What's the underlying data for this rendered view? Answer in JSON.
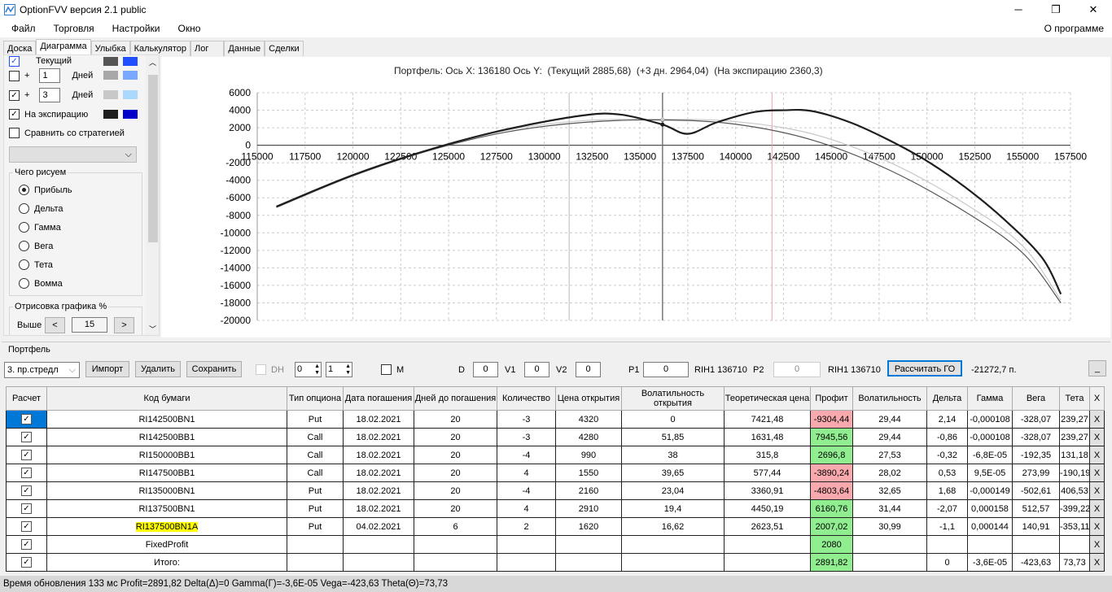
{
  "window": {
    "title": "OptionFVV версия 2.1 public",
    "minimize": "─",
    "maximize": "❐",
    "close": "✕"
  },
  "menu": {
    "items": [
      "Файл",
      "Торговля",
      "Настройки",
      "Окно"
    ],
    "about": "О программе"
  },
  "tabs": [
    "Доска",
    "Диаграмма",
    "Улыбка",
    "Калькулятор",
    "Лог",
    "Данные",
    "Сделки"
  ],
  "left": {
    "current_label": "Текущий",
    "plus": "+",
    "days_label": "Дней",
    "day1": "1",
    "day2": "3",
    "expiration_label": "На экспирацию",
    "compare_label": "Сравнить со стратегией",
    "draw_group": "Чего рисуем",
    "radios": [
      "Прибыль",
      "Дельта",
      "Гамма",
      "Вега",
      "Тета",
      "Вомма"
    ],
    "render_group": "Отрисовка графика %",
    "above_label": "Выше",
    "above_value": "15",
    "prev": "<",
    "next": ">",
    "colors": {
      "current": [
        "#555555",
        "#1f4fff"
      ],
      "d1": [
        "#a8a8a8",
        "#7aa7ff"
      ],
      "d3": [
        "#c8c8c8",
        "#aad8ff"
      ],
      "exp": [
        "#1e1e1e",
        "#0000c8"
      ]
    }
  },
  "chart_data": {
    "type": "line",
    "title": "Портфель: Ось X: 136180 Ось Y:  (Текущий 2885,68)  (+3 дн. 2964,04)  (На экспирацию 2360,3)",
    "xlim": [
      115000,
      157500
    ],
    "ylim": [
      -20000,
      6000
    ],
    "xticks": [
      "115000",
      "117500",
      "120000",
      "122500",
      "125000",
      "127500",
      "130000",
      "132500",
      "135000",
      "137500",
      "140000",
      "142500",
      "145000",
      "147500",
      "150000",
      "152500",
      "155000",
      "157500"
    ],
    "yticks": [
      "6000",
      "4000",
      "2000",
      "0",
      "-2000",
      "-4000",
      "-6000",
      "-8000",
      "-10000",
      "-12000",
      "-14000",
      "-16000",
      "-18000",
      "-20000"
    ],
    "cursor_x": 136180,
    "marker_x": 141900,
    "aux_x": 131300,
    "series": [
      {
        "name": "На экспирацию",
        "color": "#1e1e1e",
        "points": [
          [
            116000,
            -7000
          ],
          [
            120000,
            -3400
          ],
          [
            124000,
            -500
          ],
          [
            128000,
            1800
          ],
          [
            132000,
            3400
          ],
          [
            134000,
            3500
          ],
          [
            136180,
            2360
          ],
          [
            137500,
            1300
          ],
          [
            139000,
            2600
          ],
          [
            141000,
            3800
          ],
          [
            142500,
            4000
          ],
          [
            144000,
            3900
          ],
          [
            146000,
            2600
          ],
          [
            148000,
            600
          ],
          [
            150000,
            -1800
          ],
          [
            152000,
            -4800
          ],
          [
            154000,
            -8400
          ],
          [
            156000,
            -12800
          ],
          [
            157000,
            -17000
          ]
        ]
      },
      {
        "name": "Текущий",
        "color": "#555555",
        "points": [
          [
            116000,
            -7100
          ],
          [
            120000,
            -3500
          ],
          [
            124000,
            -600
          ],
          [
            128000,
            1500
          ],
          [
            132000,
            2600
          ],
          [
            136180,
            2886
          ],
          [
            140000,
            2400
          ],
          [
            144000,
            600
          ],
          [
            148000,
            -2800
          ],
          [
            152000,
            -7600
          ],
          [
            155000,
            -12300
          ],
          [
            157000,
            -18000
          ]
        ]
      },
      {
        "name": "+3 дн.",
        "color": "#c8c8c8",
        "points": [
          [
            124000,
            -500
          ],
          [
            128000,
            1700
          ],
          [
            132000,
            2800
          ],
          [
            136180,
            2964
          ],
          [
            140000,
            2700
          ],
          [
            144000,
            1300
          ],
          [
            148000,
            -1900
          ],
          [
            152000,
            -6700
          ],
          [
            155000,
            -11500
          ],
          [
            157000,
            -17700
          ]
        ]
      }
    ]
  },
  "portfolio": {
    "group": "Портфель",
    "strategy": "3. пр.стредл",
    "import": "Импорт",
    "delete": "Удалить",
    "save": "Сохранить",
    "dh": "DH",
    "spin1": "0",
    "spin2": "1",
    "m": "M",
    "d_label": "D",
    "d": "0",
    "v1_label": "V1",
    "v1": "0",
    "v2_label": "V2",
    "v2": "0",
    "p1_label": "P1",
    "p1": "0",
    "p1_info": "RIH1 136710",
    "p2_label": "P2",
    "p2": "0",
    "p2_info": "RIH1 136710",
    "calc": "Рассчитать ГО",
    "go_value": "-21272,7 п.",
    "min": "_"
  },
  "table": {
    "headers": [
      "Расчет",
      "Код бумаги",
      "Тип опциона",
      "Дата погашения",
      "Дней до погашения",
      "Количество",
      "Цена открытия",
      "Волатильность открытия",
      "Теоретическая цена",
      "Профит",
      "Волатильность",
      "Дельта",
      "Гамма",
      "Вега",
      "Тета",
      "X"
    ],
    "rows": [
      [
        "RI142500BN1",
        "Put",
        "18.02.2021",
        "20",
        "-3",
        "4320",
        "0",
        "7421,48",
        "-9304,44",
        "29,44",
        "2,14",
        "-0,000108",
        "-328,07",
        "239,27",
        "neg"
      ],
      [
        "RI142500BB1",
        "Call",
        "18.02.2021",
        "20",
        "-3",
        "4280",
        "51,85",
        "1631,48",
        "7945,56",
        "29,44",
        "-0,86",
        "-0,000108",
        "-328,07",
        "239,27",
        "pos"
      ],
      [
        "RI150000BB1",
        "Call",
        "18.02.2021",
        "20",
        "-4",
        "990",
        "38",
        "315,8",
        "2696,8",
        "27,53",
        "-0,32",
        "-6,8E-05",
        "-192,35",
        "131,18",
        "pos"
      ],
      [
        "RI147500BB1",
        "Call",
        "18.02.2021",
        "20",
        "4",
        "1550",
        "39,65",
        "577,44",
        "-3890,24",
        "28,02",
        "0,53",
        "9,5E-05",
        "273,99",
        "-190,19",
        "neg"
      ],
      [
        "RI135000BN1",
        "Put",
        "18.02.2021",
        "20",
        "-4",
        "2160",
        "23,04",
        "3360,91",
        "-4803,64",
        "32,65",
        "1,68",
        "-0,000149",
        "-502,61",
        "406,53",
        "neg"
      ],
      [
        "RI137500BN1",
        "Put",
        "18.02.2021",
        "20",
        "4",
        "2910",
        "19,4",
        "4450,19",
        "6160,76",
        "31,44",
        "-2,07",
        "0,000158",
        "512,57",
        "-399,22",
        "pos"
      ],
      [
        "RI137500BN1A",
        "Put",
        "04.02.2021",
        "6",
        "2",
        "1620",
        "16,62",
        "2623,51",
        "2007,02",
        "30,99",
        "-1,1",
        "0,000144",
        "140,91",
        "-353,11",
        "pos"
      ],
      [
        "FixedProfit",
        "",
        "",
        "",
        "",
        "",
        "",
        "",
        "2080",
        "",
        "",
        "",
        "",
        "",
        "pos"
      ],
      [
        "Итого:",
        "",
        "",
        "",
        "",
        "",
        "",
        "",
        "2891,82",
        "",
        "0",
        "-3,6E-05",
        "-423,63",
        "73,73",
        "pos"
      ]
    ],
    "remove": "X"
  },
  "status": "Время обновления 133 мс  Profit=2891,82 Delta(Δ)=0 Gamma(Γ)=-3,6E-05 Vega=-423,63 Theta(Θ)=73,73"
}
